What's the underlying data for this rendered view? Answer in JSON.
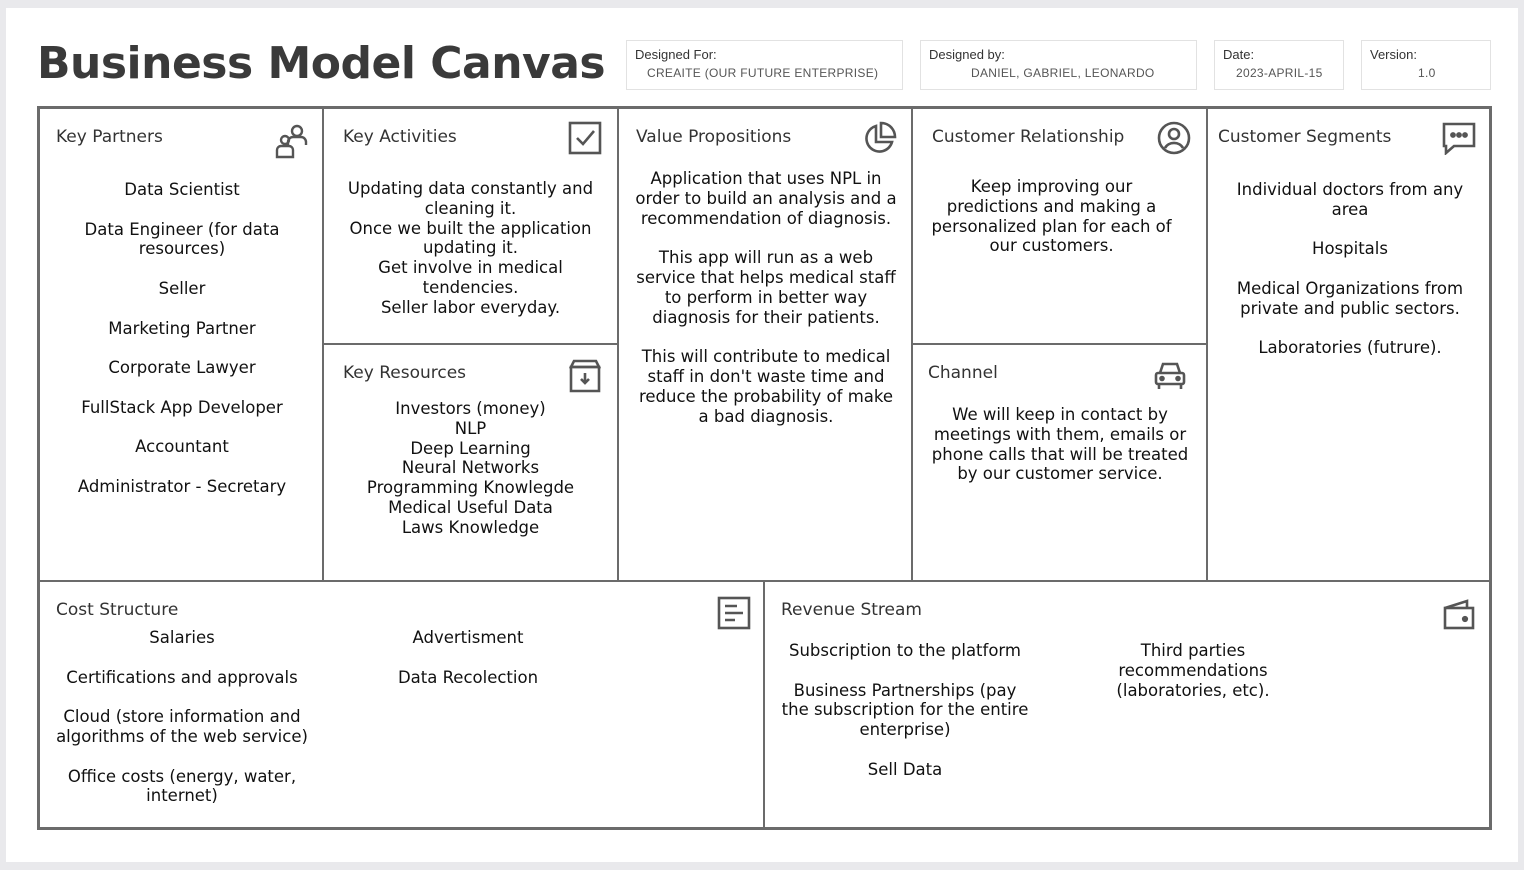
{
  "header": {
    "title": "Business Model Canvas",
    "designed_for_label": "Designed For:",
    "designed_for_value": "CREAITE  (OUR FUTURE ENTERPRISE)",
    "designed_by_label": "Designed by:",
    "designed_by_value": "DANIEL, GABRIEL, LEONARDO",
    "date_label": "Date:",
    "date_value": "2023-APRIL-15",
    "version_label": "Version:",
    "version_value": "1.0"
  },
  "key_partners": {
    "title": "Key Partners",
    "icon": "partners-icon",
    "items": [
      "Data Scientist",
      "Data Engineer (for data resources)",
      "Seller",
      "Marketing Partner",
      "Corporate Lawyer",
      "FullStack App Developer",
      "Accountant",
      "Administrator - Secretary"
    ]
  },
  "key_activities": {
    "title": "Key Activities",
    "icon": "checkbox-icon",
    "items": [
      "Updating data constantly and cleaning it.",
      "Once we built the application updating it.",
      "Get involve in medical tendencies.",
      "Seller labor everyday."
    ]
  },
  "key_resources": {
    "title": "Key Resources",
    "icon": "archive-box-icon",
    "items": [
      "Investors (money)",
      "NLP",
      "Deep Learning",
      "Neural Networks",
      "Programming Knowlegde",
      "Medical Useful Data",
      "Laws Knowledge"
    ]
  },
  "value_propositions": {
    "title": "Value Propositions",
    "icon": "pie-chart-icon",
    "items": [
      "Application that uses NPL in order to build an analysis and a recommendation of diagnosis.",
      "This app will run as a web service that helps medical staff to perform in better way diagnosis for their patients.",
      "This will contribute to medical staff in don't waste time and reduce the probability of make a bad diagnosis."
    ]
  },
  "customer_relationship": {
    "title": "Customer Relationship",
    "icon": "user-circle-icon",
    "items": [
      "Keep improving our predictions and making a personalized plan for each of our customers."
    ]
  },
  "channel": {
    "title": "Channel",
    "icon": "car-icon",
    "items": [
      "We will keep in contact by meetings with them, emails or phone calls that will be treated by our customer service."
    ]
  },
  "customer_segments": {
    "title": "Customer Segments",
    "icon": "chat-bubble-icon",
    "items": [
      "Individual doctors from any area",
      "Hospitals",
      "Medical Organizations from private and public sectors.",
      "Laboratories (futrure)."
    ]
  },
  "cost_structure": {
    "title": "Cost Structure",
    "icon": "document-lines-icon",
    "col1": [
      "Salaries",
      "Certifications and approvals",
      "Cloud (store information and algorithms of the web service)",
      "Office costs (energy, water, internet)"
    ],
    "col2": [
      "Advertisment",
      "Data Recolection"
    ]
  },
  "revenue_stream": {
    "title": "Revenue Stream",
    "icon": "wallet-icon",
    "col1": [
      "Subscription to the platform",
      "Business Partnerships (pay the subscription for the entire enterprise)",
      "Sell Data"
    ],
    "col2": [
      "Third parties recommendations (laboratories, etc)."
    ]
  }
}
